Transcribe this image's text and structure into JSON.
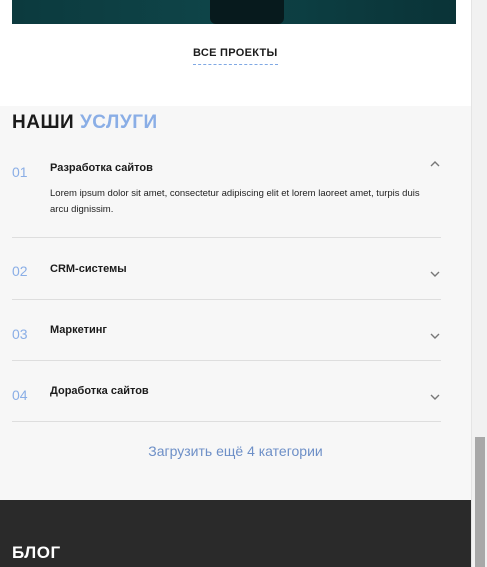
{
  "top": {
    "all_projects_label": "ВСЕ ПРОЕКТЫ"
  },
  "services": {
    "title_part1": "НАШИ",
    "title_part2": "УСЛУГИ",
    "items": [
      {
        "num": "01",
        "title": "Разработка сайтов",
        "expanded": true,
        "body": "Lorem ipsum dolor sit amet, consectetur adipiscing elit et lorem laoreet amet, turpis duis arcu dignissim."
      },
      {
        "num": "02",
        "title": "CRM-системы",
        "expanded": false
      },
      {
        "num": "03",
        "title": "Маркетинг",
        "expanded": false
      },
      {
        "num": "04",
        "title": "Доработка сайтов",
        "expanded": false
      }
    ],
    "load_more_label": "Загрузить ещё 4 категории"
  },
  "blog": {
    "title": "БЛОГ"
  },
  "colors": {
    "accent": "#8aaee6",
    "link": "#6d8fc7",
    "dark_section": "#2a2a2a",
    "hero": "#0e4448"
  },
  "icons": {
    "expanded": "chevron-up-icon",
    "collapsed": "chevron-down-icon"
  }
}
